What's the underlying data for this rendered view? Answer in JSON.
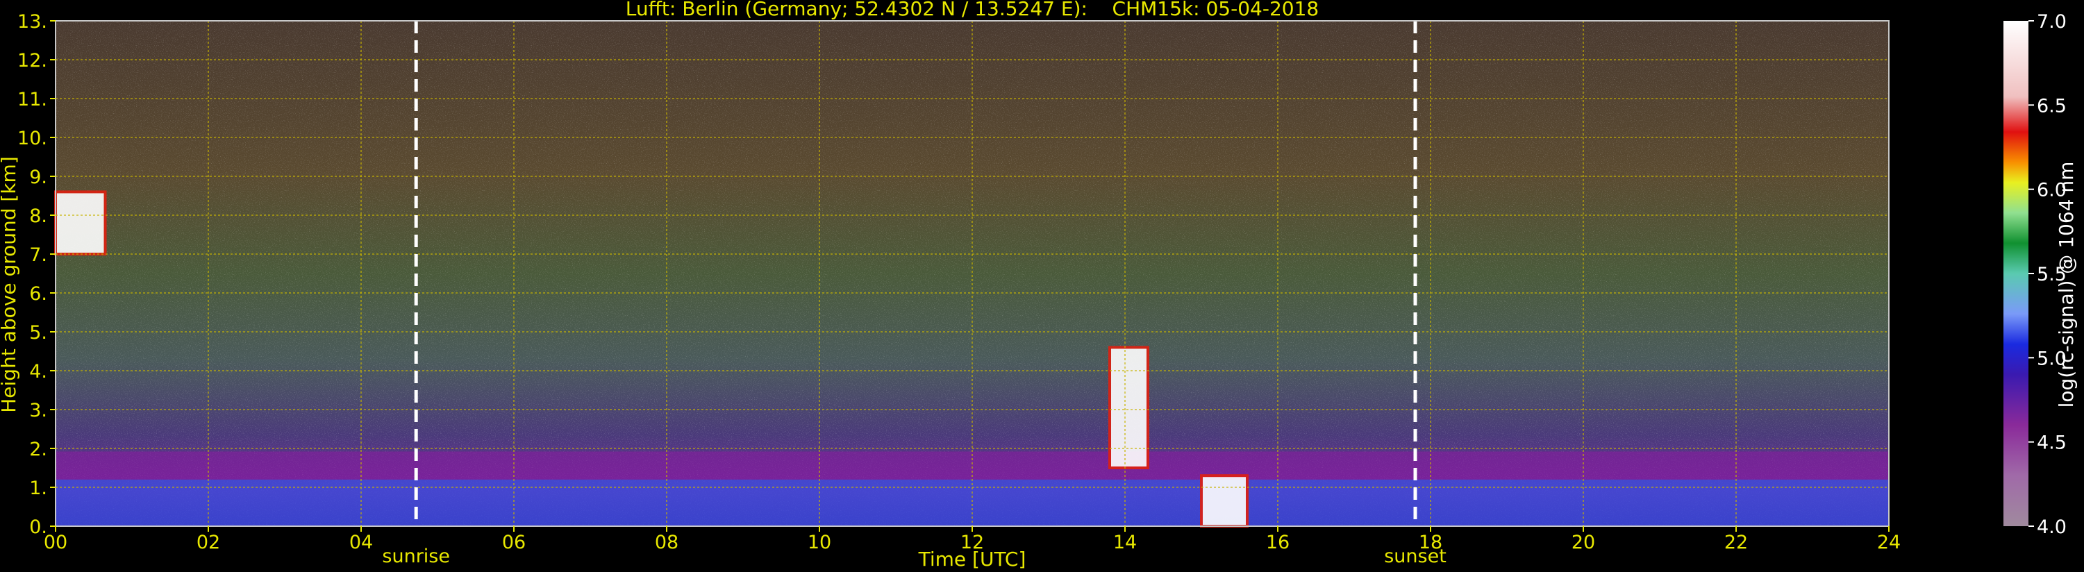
{
  "chart_data": {
    "type": "heatmap",
    "title": "Lufft: Berlin (Germany; 52.4302 N / 13.5247 E):    CHM15k: 05-04-2018",
    "xlabel": "Time [UTC]",
    "ylabel": "Height above ground [km]",
    "xlim": [
      0,
      24
    ],
    "ylim": [
      0,
      13
    ],
    "x_ticks": [
      "00",
      "02",
      "04",
      "06",
      "08",
      "10",
      "12",
      "14",
      "16",
      "18",
      "20",
      "22",
      "24"
    ],
    "y_ticks": [
      "0.",
      "1.",
      "2.",
      "3.",
      "4.",
      "5.",
      "6.",
      "7.",
      "8.",
      "9.",
      "10.",
      "11.",
      "12.",
      "13."
    ],
    "grid": true,
    "events": [
      {
        "label": "sunrise",
        "time": 4.72
      },
      {
        "label": "sunset",
        "time": 17.8
      }
    ],
    "colorbar": {
      "label": "log(rc-signal) @ 1064 nm",
      "range": [
        4.0,
        7.0
      ],
      "ticks": [
        "4.0",
        "4.5",
        "5.0",
        "5.5",
        "6.0",
        "6.5",
        "7.0"
      ],
      "colors": [
        "#a08a9e",
        "#a06aa8",
        "#8a2a9a",
        "#6a0090",
        "#3a1ab0",
        "#1a2ae0",
        "#3a6af0",
        "#7a9af8",
        "#9ab8f0",
        "#5acab0",
        "#20b070",
        "#109030",
        "#40d060",
        "#90e090",
        "#e8f020",
        "#f8c000",
        "#f89000",
        "#f05010",
        "#e01010",
        "#f0a0a0",
        "#f0e0e0",
        "#ffffff"
      ]
    },
    "features": [
      {
        "name": "boundary layer",
        "t_start": 0,
        "t_end": 24,
        "top_km": 1.2
      },
      {
        "name": "cloud",
        "t_start": 0.0,
        "t_end": 0.65,
        "base_km": 7.0,
        "top_km": 8.6
      },
      {
        "name": "cloud",
        "t_start": 13.8,
        "t_end": 14.3,
        "base_km": 1.5,
        "top_km": 4.6
      },
      {
        "name": "cloud",
        "t_start": 15.0,
        "t_end": 15.6,
        "base_km": 0.0,
        "top_km": 1.3
      }
    ]
  }
}
